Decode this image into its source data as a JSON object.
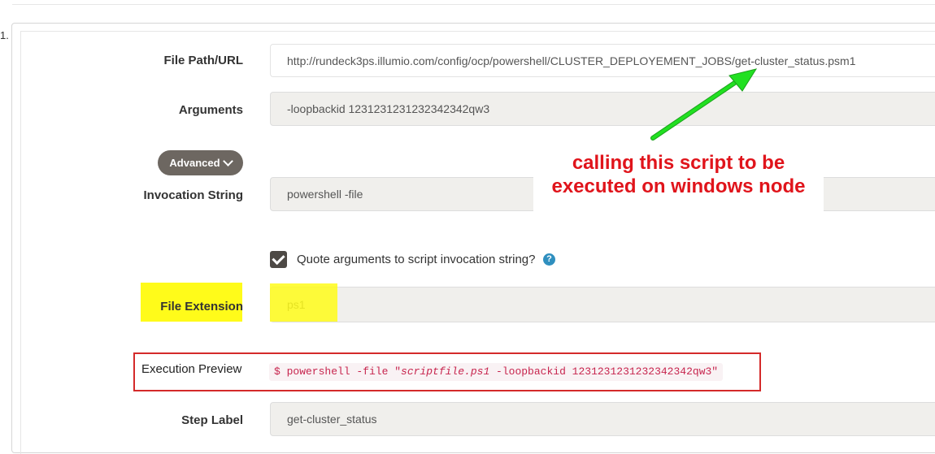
{
  "step": {
    "number": "1."
  },
  "fields": {
    "file_path": {
      "label": "File Path/URL",
      "value": "http://rundeck3ps.illumio.com/config/ocp/powershell/CLUSTER_DEPLOYEMENT_JOBS/get-cluster_status.psm1"
    },
    "arguments": {
      "label": "Arguments",
      "value": "-loopbackid 1231231231232342342qw3"
    },
    "advanced_button": {
      "label": "Advanced"
    },
    "invocation_string": {
      "label": "Invocation String",
      "value": "powershell -file"
    },
    "quote_arguments": {
      "label": "Quote arguments to script invocation string?",
      "checked": true
    },
    "file_extension": {
      "label": "File Extension",
      "value": "ps1"
    },
    "execution_preview": {
      "label": "Execution Preview",
      "prefix": "$ powershell -file \"",
      "script": "scriptfile.ps1",
      "suffix": " -loopbackid 1231231231232342342qw3\""
    },
    "step_label": {
      "label": "Step Label",
      "value": "get-cluster_status"
    }
  },
  "annotation": {
    "line1": "calling this script to be",
    "line2": "executed on windows node",
    "color": "#e0141b",
    "arrow_color": "#21e021"
  },
  "highlights": {
    "yellow": "#fffb1a",
    "red_box": "#d42a2a"
  },
  "icons": [
    "chevron-down-icon",
    "check-icon",
    "help-icon",
    "arrow-icon"
  ]
}
